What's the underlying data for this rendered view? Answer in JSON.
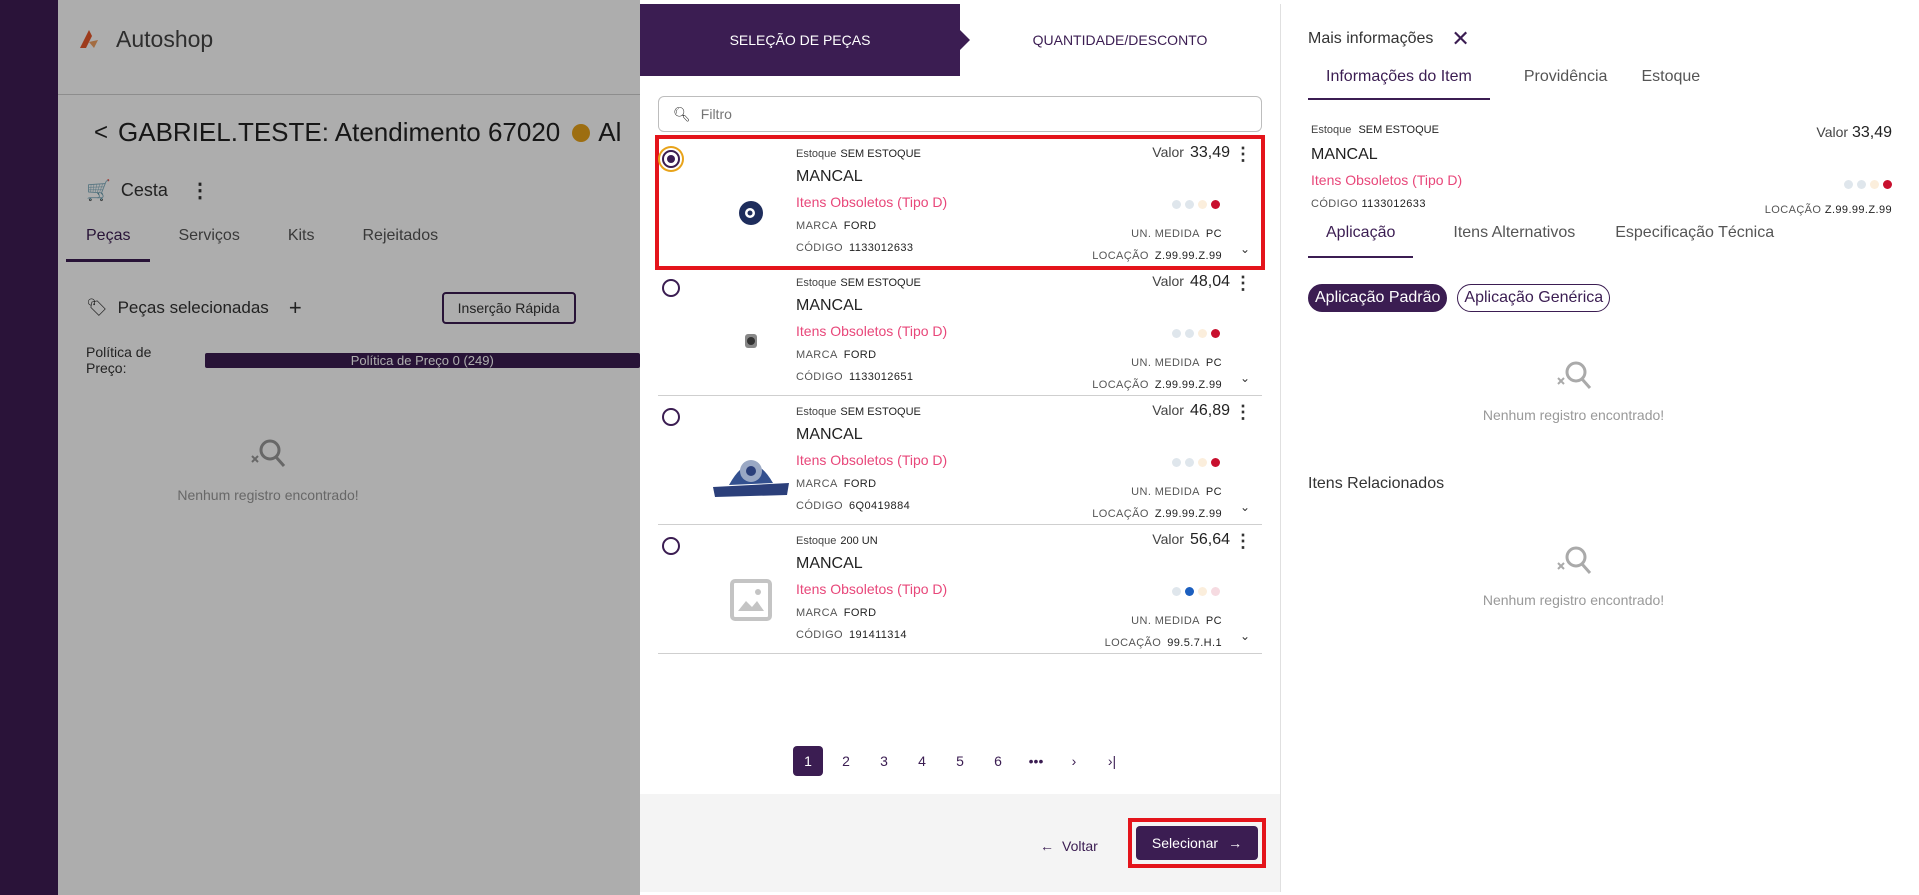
{
  "background": {
    "app_name": "Autoshop",
    "title_prefix": "<",
    "title": "GABRIEL.TESTE: Atendimento 67020",
    "title_trunc": "Al",
    "cesta_label": "Cesta",
    "tabs": [
      "Peças",
      "Serviços",
      "Kits",
      "Rejeitados"
    ],
    "pecas_selecionadas": "Peças selecionadas",
    "insercao_rapida": "Inserção Rápida",
    "politica_label": "Política de Preço:",
    "politica_value": "Política de Preço 0 (249)",
    "empty_text": "Nenhum registro encontrado!"
  },
  "steps": [
    "SELEÇÃO DE PEÇAS",
    "QUANTIDADE/DESCONTO"
  ],
  "filter_placeholder": "Filtro",
  "items": [
    {
      "estoque": "SEM ESTOQUE",
      "valor": "33,49",
      "name": "MANCAL",
      "group": "Itens Obsoletos (Tipo D)",
      "marca": "FORD",
      "un": "PC",
      "codigo": "1133012633",
      "locacao": "Z.99.99.Z.99",
      "selected": true
    },
    {
      "estoque": "SEM ESTOQUE",
      "valor": "48,04",
      "name": "MANCAL",
      "group": "Itens Obsoletos (Tipo D)",
      "marca": "FORD",
      "un": "PC",
      "codigo": "1133012651",
      "locacao": "Z.99.99.Z.99",
      "selected": false
    },
    {
      "estoque": "SEM ESTOQUE",
      "valor": "46,89",
      "name": "MANCAL",
      "group": "Itens Obsoletos (Tipo D)",
      "marca": "FORD",
      "un": "PC",
      "codigo": "6Q0419884",
      "locacao": "Z.99.99.Z.99",
      "selected": false
    },
    {
      "estoque": "200 UN",
      "valor": "56,64",
      "name": "MANCAL",
      "group": "Itens Obsoletos (Tipo D)",
      "marca": "FORD",
      "un": "PC",
      "codigo": "191411314",
      "locacao": "99.5.7.H.1",
      "selected": false
    }
  ],
  "labels": {
    "estoque": "Estoque",
    "valor": "Valor",
    "marca": "MARCA",
    "un_medida": "UN. MEDIDA",
    "codigo": "CÓDIGO",
    "locacao": "LOCAÇÃO"
  },
  "pagination": [
    "1",
    "2",
    "3",
    "4",
    "5",
    "6",
    "•••",
    "›",
    "›|"
  ],
  "footer": {
    "voltar": "Voltar",
    "selecionar": "Selecionar"
  },
  "right": {
    "header": "Mais informações",
    "tabs": [
      "Informações do Item",
      "Providência",
      "Estoque"
    ],
    "info": {
      "estoque_label": "Estoque",
      "estoque": "SEM ESTOQUE",
      "valor_label": "Valor",
      "valor": "33,49",
      "name": "MANCAL",
      "group": "Itens Obsoletos (Tipo D)",
      "codigo_label": "CÓDIGO",
      "codigo": "1133012633",
      "locacao_label": "LOCAÇÃO",
      "locacao": "Z.99.99.Z.99"
    },
    "sub_tabs": [
      "Aplicação",
      "Itens Alternativos",
      "Especificação Técnica"
    ],
    "chips": [
      "Aplicação Padrão",
      "Aplicação Genérica"
    ],
    "empty_text": "Nenhum registro encontrado!",
    "related_title": "Itens Relacionados",
    "empty_text_2": "Nenhum registro encontrado!"
  },
  "colors": {
    "primary": "#3b1d52",
    "highlight": "#e4141b",
    "obsolete": "#e8477a"
  }
}
